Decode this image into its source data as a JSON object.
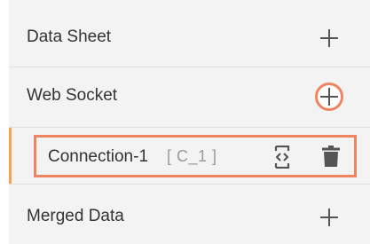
{
  "rows": [
    {
      "label": "Data Sheet",
      "action_icon": "plus-icon"
    },
    {
      "label": "Web Socket",
      "action_icon": "plus-icon",
      "highlighted": true
    },
    {
      "label": "Merged Data",
      "action_icon": "plus-icon"
    }
  ],
  "connection": {
    "name": "Connection-1",
    "id_label": "[ C_1 ]",
    "icons": [
      "code-edit-icon",
      "trash-icon"
    ]
  },
  "colors": {
    "highlight": "#ee8560",
    "accent": "#f2a54a",
    "row_background": "#f3f3f3",
    "divider": "#dedede"
  }
}
